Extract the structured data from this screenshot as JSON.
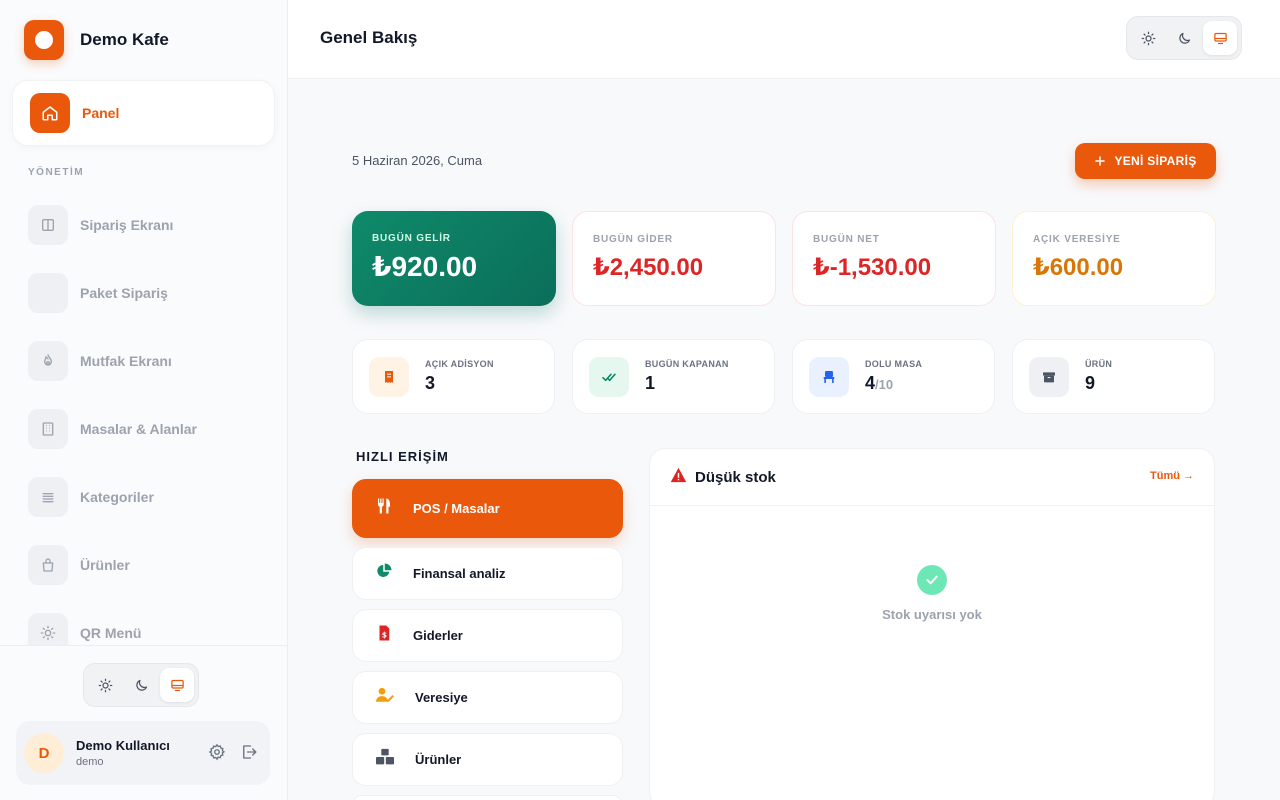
{
  "brand": {
    "name": "Demo Kafe"
  },
  "sidebar": {
    "active": {
      "label": "Panel",
      "icon": "home-icon"
    },
    "section_label": "YÖNETİM",
    "items": [
      {
        "label": "Sipariş Ekranı",
        "icon": "columns-icon"
      },
      {
        "label": "Paket Sipariş",
        "icon": "package-icon"
      },
      {
        "label": "Mutfak Ekranı",
        "icon": "flame-icon"
      },
      {
        "label": "Masalar & Alanlar",
        "icon": "building-icon"
      },
      {
        "label": "Kategoriler",
        "icon": "list-icon"
      },
      {
        "label": "Ürünler",
        "icon": "bag-icon"
      },
      {
        "label": "QR Menü",
        "icon": "sun-icon"
      }
    ],
    "theme_options": [
      "sun-icon",
      "moon-icon",
      "monitor-icon"
    ],
    "theme_selected": "monitor"
  },
  "user": {
    "initial": "D",
    "name": "Demo Kullanıcı",
    "role": "demo"
  },
  "header": {
    "title": "Genel Bakış"
  },
  "main": {
    "date": "5 Haziran 2026, Cuma",
    "new_order_label": "YENİ SİPARİŞ",
    "stats": [
      {
        "label": "BUGÜN GELİR",
        "value": "₺920.00",
        "color": "#ffffff"
      },
      {
        "label": "BUGÜN GİDER",
        "value": "₺2,450.00",
        "color": "#dc2626"
      },
      {
        "label": "BUGÜN NET",
        "value": "₺-1,530.00",
        "color": "#dc2626"
      },
      {
        "label": "AÇIK VERESİYE",
        "value": "₺600.00",
        "color": "#d97706"
      }
    ],
    "mini_stats": [
      {
        "label": "AÇIK ADİSYON",
        "value": "3",
        "sub": ""
      },
      {
        "label": "BUGÜN KAPANAN",
        "value": "1",
        "sub": ""
      },
      {
        "label": "DOLU MASA",
        "value": "4",
        "sub": "/10"
      },
      {
        "label": "ÜRÜN",
        "value": "9",
        "sub": ""
      }
    ],
    "quick_title": "HIZLI ERİŞİM",
    "quick_items": [
      {
        "label": "POS / Masalar"
      },
      {
        "label": "Finansal analiz"
      },
      {
        "label": "Giderler"
      },
      {
        "label": "Veresiye"
      },
      {
        "label": "Ürünler"
      }
    ],
    "stock": {
      "title": "Düşük stok",
      "all_link": "Tümü →",
      "empty_text": "Stok uyarısı yok"
    }
  },
  "colors": {
    "accent": "#ea580c",
    "income": "#0f8a6a"
  }
}
